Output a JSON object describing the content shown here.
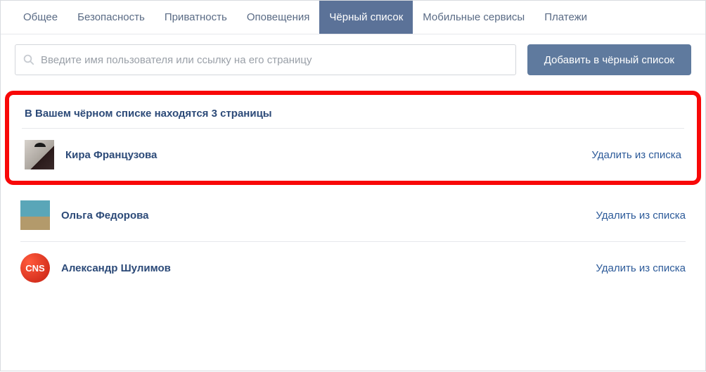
{
  "tabs": [
    {
      "label": "Общее"
    },
    {
      "label": "Безопасность"
    },
    {
      "label": "Приватность"
    },
    {
      "label": "Оповещения"
    },
    {
      "label": "Чёрный список",
      "active": true
    },
    {
      "label": "Мобильные сервисы"
    },
    {
      "label": "Платежи"
    }
  ],
  "search": {
    "placeholder": "Введите имя пользователя или ссылку на его страницу"
  },
  "buttons": {
    "add": "Добавить в чёрный список"
  },
  "section_title": "В Вашем чёрном списке находятся 3 страницы",
  "users": [
    {
      "name": "Кира Французова",
      "avatar_name": "avatar-user-1",
      "avatar_class": "avatar-photo1",
      "remove": "Удалить из списка"
    },
    {
      "name": "Ольга Федорова",
      "avatar_name": "avatar-user-2",
      "avatar_class": "avatar-photo2",
      "remove": "Удалить из списка"
    },
    {
      "name": "Александр Шулимов",
      "avatar_name": "avatar-user-3",
      "avatar_class": "avatar-cns",
      "avatar_text": "CNS",
      "remove": "Удалить из списка"
    }
  ]
}
